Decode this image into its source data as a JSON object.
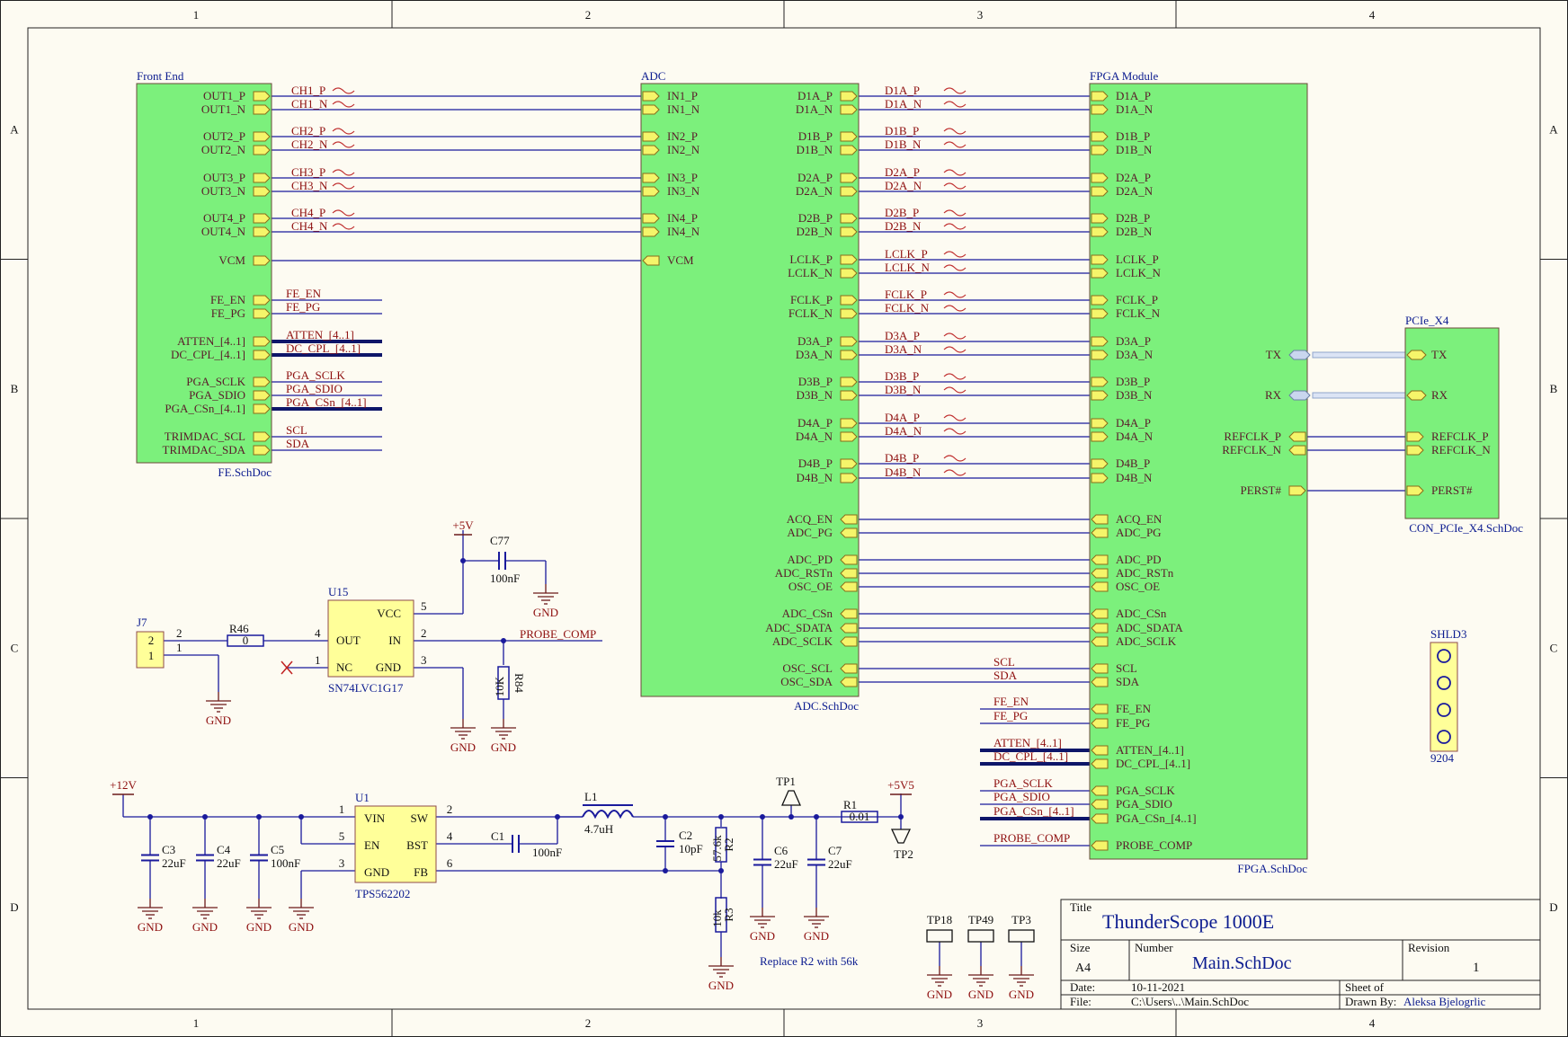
{
  "frame": {
    "cols": [
      "1",
      "2",
      "3",
      "4"
    ],
    "rows": [
      "A",
      "B",
      "C",
      "D"
    ]
  },
  "sheets": {
    "fe": {
      "title": "Front End",
      "file": "FE.SchDoc",
      "ports": [
        "OUT1_P",
        "OUT1_N",
        "OUT2_P",
        "OUT2_N",
        "OUT3_P",
        "OUT3_N",
        "OUT4_P",
        "OUT4_N",
        "VCM",
        "FE_EN",
        "FE_PG",
        "ATTEN_[4..1]",
        "DC_CPL_[4..1]",
        "PGA_SCLK",
        "PGA_SDIO",
        "PGA_CSn_[4..1]",
        "TRIMDAC_SCL",
        "TRIMDAC_SDA"
      ]
    },
    "adc": {
      "title": "ADC",
      "file": "ADC.SchDoc",
      "inputs": [
        "IN1_P",
        "IN1_N",
        "IN2_P",
        "IN2_N",
        "IN3_P",
        "IN3_N",
        "IN4_P",
        "IN4_N",
        "VCM"
      ],
      "outputs": [
        "D1A_P",
        "D1A_N",
        "D1B_P",
        "D1B_N",
        "D2A_P",
        "D2A_N",
        "D2B_P",
        "D2B_N",
        "LCLK_P",
        "LCLK_N",
        "FCLK_P",
        "FCLK_N",
        "D3A_P",
        "D3A_N",
        "D3B_P",
        "D3B_N",
        "D4A_P",
        "D4A_N",
        "D4B_P",
        "D4B_N",
        "ACQ_EN",
        "ADC_PG",
        "ADC_PD",
        "ADC_RSTn",
        "OSC_OE",
        "ADC_CSn",
        "ADC_SDATA",
        "ADC_SCLK",
        "OSC_SCL",
        "OSC_SDA"
      ]
    },
    "fpga": {
      "title": "FPGA Module",
      "file": "FPGA.SchDoc",
      "left": [
        "D1A_P",
        "D1A_N",
        "D1B_P",
        "D1B_N",
        "D2A_P",
        "D2A_N",
        "D2B_P",
        "D2B_N",
        "LCLK_P",
        "LCLK_N",
        "FCLK_P",
        "FCLK_N",
        "D3A_P",
        "D3A_N",
        "D3B_P",
        "D3B_N",
        "D4A_P",
        "D4A_N",
        "D4B_P",
        "D4B_N",
        "ACQ_EN",
        "ADC_PG",
        "ADC_PD",
        "ADC_RSTn",
        "OSC_OE",
        "ADC_CSn",
        "ADC_SDATA",
        "ADC_SCLK",
        "SCL",
        "SDA",
        "FE_EN",
        "FE_PG",
        "ATTEN_[4..1]",
        "DC_CPL_[4..1]",
        "PGA_SCLK",
        "PGA_SDIO",
        "PGA_CSn_[4..1]",
        "PROBE_COMP"
      ],
      "right": [
        "TX",
        "RX",
        "REFCLK_P",
        "REFCLK_N",
        "PERST#"
      ]
    },
    "pcie": {
      "title": "PCIe_X4",
      "file": "CON_PCIe_X4.SchDoc",
      "ports": [
        "TX",
        "RX",
        "REFCLK_P",
        "REFCLK_N",
        "PERST#"
      ]
    }
  },
  "nets": {
    "fe_adc": [
      "CH1_P",
      "CH1_N",
      "CH2_P",
      "CH2_N",
      "CH3_P",
      "CH3_N",
      "CH4_P",
      "CH4_N"
    ],
    "adc_fpga": [
      "D1A_P",
      "D1A_N",
      "D1B_P",
      "D1B_N",
      "D2A_P",
      "D2A_N",
      "D2B_P",
      "D2B_N",
      "LCLK_P",
      "LCLK_N",
      "FCLK_P",
      "FCLK_N",
      "D3A_P",
      "D3A_N",
      "D3B_P",
      "D3B_N",
      "D4A_P",
      "D4A_N",
      "D4B_P",
      "D4B_N"
    ],
    "fe_out": [
      "FE_EN",
      "FE_PG",
      "ATTEN_[4..1]",
      "DC_CPL_[4..1]",
      "PGA_SCLK",
      "PGA_SDIO",
      "PGA_CSn_[4..1]",
      "SCL",
      "SDA"
    ],
    "fpga_in": [
      "FE_EN",
      "FE_PG",
      "ATTEN_[4..1]",
      "DC_CPL_[4..1]",
      "PGA_SCLK",
      "PGA_SDIO",
      "PGA_CSn_[4..1]",
      "PROBE_COMP"
    ],
    "i2c": [
      "SCL",
      "SDA"
    ],
    "probe_comp": "PROBE_COMP"
  },
  "probe_circuit": {
    "supply": "+5V",
    "cap_ref": "C77",
    "cap_val": "100nF",
    "ic_ref": "U15",
    "ic_part": "SN74LVC1G17",
    "ic_pins_left": [
      "OUT",
      "NC"
    ],
    "ic_pins_right": [
      "VCC",
      "IN",
      "GND"
    ],
    "pin_numbers": [
      "5",
      "4",
      "2",
      "1",
      "3"
    ],
    "conn_ref": "J7",
    "conn_pins": [
      "2",
      "1"
    ],
    "wire_pins": [
      "2",
      "1"
    ],
    "res_ref": "R46",
    "res_val": "0",
    "pull_ref": "R84",
    "pull_val": "10K",
    "gnd": "GND"
  },
  "power_circuit": {
    "input": "+12V",
    "caps_in": [
      {
        "ref": "C3",
        "val": "22uF"
      },
      {
        "ref": "C4",
        "val": "22uF"
      },
      {
        "ref": "C5",
        "val": "100nF"
      }
    ],
    "ic_ref": "U1",
    "ic_part": "TPS562202",
    "ic_pins_left": [
      "VIN",
      "EN",
      "GND"
    ],
    "ic_pins_right": [
      "SW",
      "BST",
      "FB"
    ],
    "pin_numbers": [
      "1",
      "5",
      "3",
      "2",
      "4",
      "6"
    ],
    "c1": {
      "ref": "C1",
      "val": "100nF"
    },
    "l1": {
      "ref": "L1",
      "val": "4.7uH"
    },
    "c2": {
      "ref": "C2",
      "val": "10pF"
    },
    "r2": {
      "ref": "R2",
      "val": "57.6k"
    },
    "r3": {
      "ref": "R3",
      "val": "10k"
    },
    "c6": {
      "ref": "C6",
      "val": "22uF"
    },
    "c7": {
      "ref": "C7",
      "val": "22uF"
    },
    "r1": {
      "ref": "R1",
      "val": "0.01"
    },
    "tp1": "TP1",
    "tp2": "TP2",
    "output": "+5V5",
    "note": "Replace R2 with 56k",
    "gnd": "GND"
  },
  "testpoints": [
    "TP18",
    "TP49",
    "TP3"
  ],
  "shield": {
    "ref": "SHLD3",
    "part": "9204"
  },
  "title_block": {
    "title_label": "Title",
    "title": "ThunderScope 1000E",
    "size_label": "Size",
    "size": "A4",
    "number_label": "Number",
    "number": "Main.SchDoc",
    "revision_label": "Revision",
    "revision": "1",
    "date_label": "Date:",
    "date": "10-11-2021",
    "sheet_label": "Sheet  of",
    "file_label": "File:",
    "file": "C:\\Users\\..\\Main.SchDoc",
    "drawn_label": "Drawn By:",
    "drawn": "Aleksa Bjelogrlic"
  },
  "colors": {
    "block_fill": "#7cf07c",
    "wire": "#1a1a9c",
    "bus": "#0e1669",
    "port": "#f5f56a",
    "net_label": "#8e0f0f"
  }
}
